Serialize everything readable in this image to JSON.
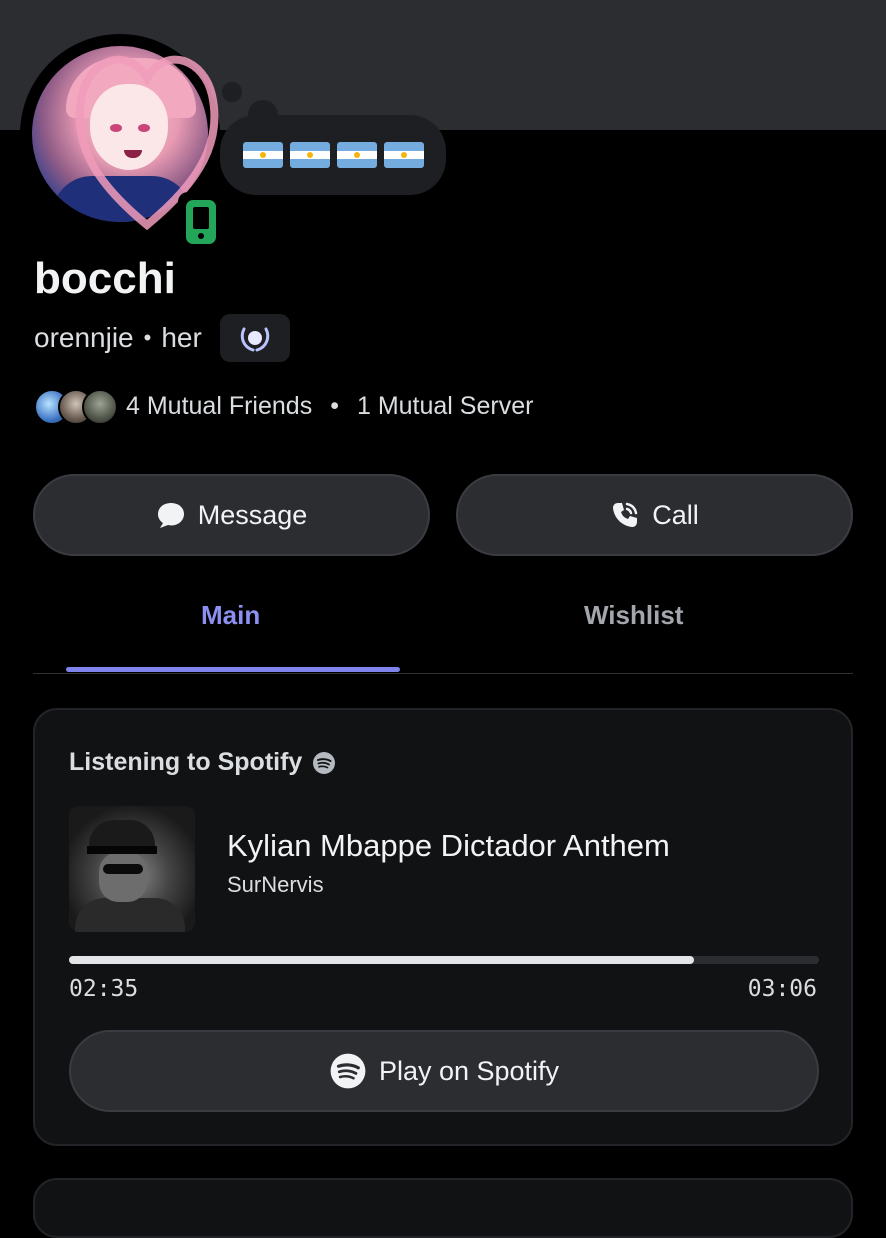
{
  "profile": {
    "display_name": "bocchi",
    "username": "orennjie",
    "pronouns": "her",
    "status": "mobile-online",
    "status_color": "#23a55a",
    "custom_status_flags": [
      "🇦🇷",
      "🇦🇷",
      "🇦🇷",
      "🇦🇷"
    ],
    "badge_icon": "laurel-badge-icon"
  },
  "mutuals": {
    "friends": "4 Mutual Friends",
    "servers": "1 Mutual Server"
  },
  "actions": {
    "message_label": "Message",
    "call_label": "Call"
  },
  "tabs": [
    {
      "label": "Main",
      "active": true
    },
    {
      "label": "Wishlist",
      "active": false
    }
  ],
  "activity": {
    "title": "Listening to Spotify",
    "song": "Kylian Mbappe Dictador Anthem",
    "artist": "SurNervis",
    "elapsed": "02:35",
    "duration": "03:06",
    "progress_fraction": 0.833,
    "play_label": "Play on Spotify"
  },
  "colors": {
    "accent": "#8c90f0",
    "background": "#000000",
    "card": "#111214"
  }
}
